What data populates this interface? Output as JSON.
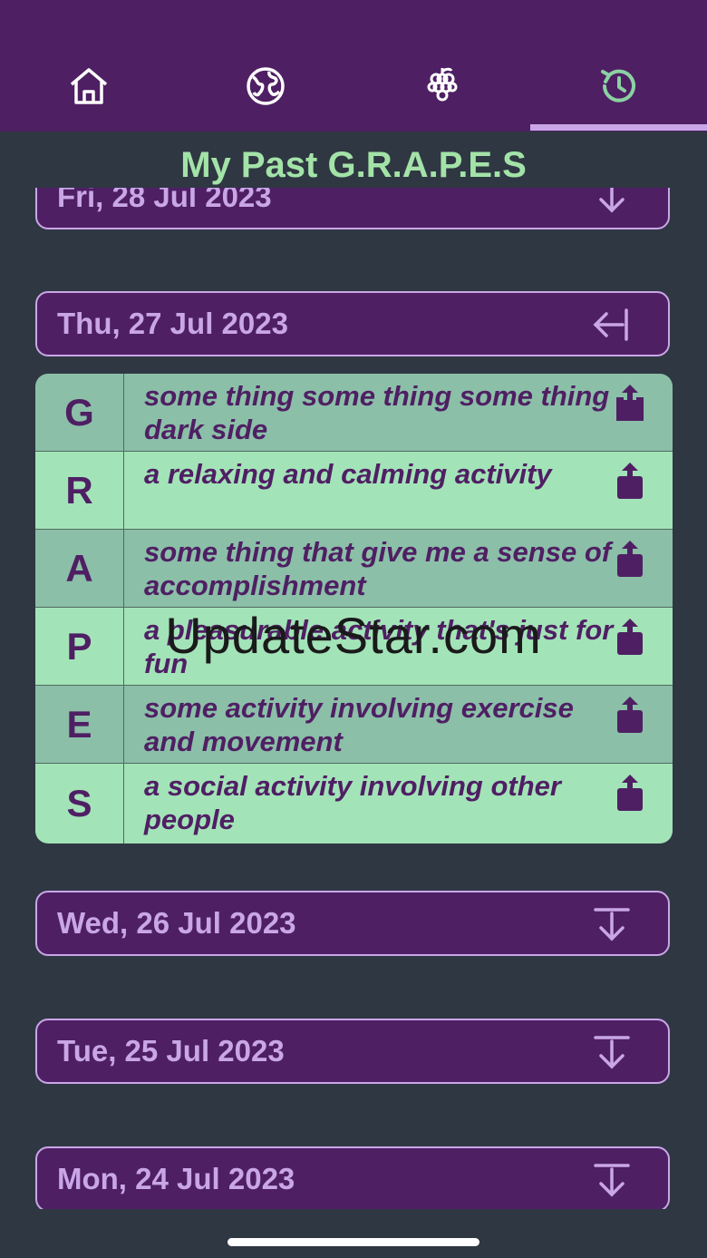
{
  "header": {
    "title": "My Past G.R.A.P.E.S",
    "tabs": [
      {
        "name": "home-tab",
        "icon": "home-icon"
      },
      {
        "name": "globe-tab",
        "icon": "globe-icon"
      },
      {
        "name": "grapes-tab",
        "icon": "grapes-icon"
      },
      {
        "name": "history-tab",
        "icon": "history-icon",
        "selected": true
      }
    ]
  },
  "dates": [
    {
      "label": "Fri, 28 Jul 2023",
      "icon": "arrow-down-icon"
    },
    {
      "label": "Thu, 27 Jul 2023",
      "icon": "collapse-left-icon",
      "expanded": true
    },
    {
      "label": "Wed, 26 Jul 2023",
      "icon": "expand-down-icon"
    },
    {
      "label": "Tue, 25 Jul 2023",
      "icon": "expand-down-icon"
    },
    {
      "label": "Mon, 24 Jul 2023",
      "icon": "expand-down-icon"
    }
  ],
  "grapes": [
    {
      "letter": "G",
      "text": "some thing some thing some thing dark side",
      "icon": "share-icon"
    },
    {
      "letter": "R",
      "text": "a relaxing and calming activity",
      "icon": "share-icon"
    },
    {
      "letter": "A",
      "text": "some thing that give me a sense of accomplishment",
      "icon": "share-icon"
    },
    {
      "letter": "P",
      "text": "a pleasurable activity that's just for fun",
      "icon": "share-icon"
    },
    {
      "letter": "E",
      "text": "some activity involving exercise and movement",
      "icon": "share-icon"
    },
    {
      "letter": "S",
      "text": "a social activity involving other people",
      "icon": "share-icon"
    }
  ],
  "watermark": "UpdateStar.com",
  "colors": {
    "purple": "#4f1f63",
    "lavender": "#c9a6e8",
    "mint": "#a3e3b8",
    "sage": "#8bbfa8",
    "background": "#2f3742",
    "title_green": "#a3e3a8",
    "history_tab_icon": "#8bd1a3"
  }
}
